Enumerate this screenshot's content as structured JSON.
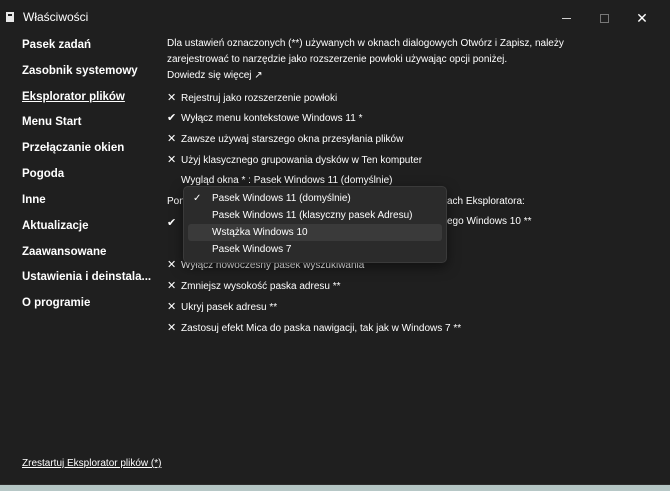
{
  "window": {
    "title": "Właściwości",
    "close_glyph": "✕"
  },
  "sidebar": {
    "items": [
      {
        "label": "Pasek zadań"
      },
      {
        "label": "Zasobnik systemowy"
      },
      {
        "label": "Eksplorator plików"
      },
      {
        "label": "Menu Start"
      },
      {
        "label": "Przełączanie okien"
      },
      {
        "label": "Pogoda"
      },
      {
        "label": "Inne"
      },
      {
        "label": "Aktualizacje"
      },
      {
        "label": "Zaawansowane"
      },
      {
        "label": "Ustawienia i deinstala..."
      },
      {
        "label": "O programie"
      }
    ],
    "restart_link": "Zrestartuj Eksplorator plików (*)"
  },
  "main": {
    "intro_line1": "Dla ustawień oznaczonych (**) używanych w oknach dialogowych Otwórz i Zapisz, należy",
    "intro_line2": "zarejestrować to narzędzie jako rozszerzenie powłoki używając opcji poniżej.",
    "learn_more": "Dowiedz się więcej ↗",
    "options_a": [
      {
        "mark": "✕",
        "label": "Rejestruj jako rozszerzenie powłoki"
      },
      {
        "mark": "✔",
        "label": "Wyłącz menu kontekstowe Windows 11 *"
      },
      {
        "mark": "✕",
        "label": "Zawsze używaj starszego okna przesyłania plików"
      },
      {
        "mark": "✕",
        "label": "Użyj klasycznego grupowania dysków w Ten komputer"
      }
    ],
    "appearance_label": "Wygląd okna * : Pasek Windows 11 (domyślnie)",
    "partial_left": "Pon",
    "partial_right": "ach Eksploratora:",
    "partial_mark": "✔",
    "partial_right2": "ego Windows 10 **",
    "options_b": [
      {
        "mark": "✕",
        "label": "Wyłącz nowoczesny pasek wyszukiwania"
      },
      {
        "mark": "✕",
        "label": "Zmniejsz wysokość paska adresu **"
      },
      {
        "mark": "✕",
        "label": "Ukryj pasek adresu **"
      },
      {
        "mark": "✕",
        "label": "Zastosuj efekt Mica do paska nawigacji, tak jak w Windows 7 **"
      }
    ]
  },
  "dropdown": {
    "check_glyph": "✓",
    "items": [
      {
        "label": "Pasek Windows 11 (domyślnie)",
        "selected": "✓"
      },
      {
        "label": "Pasek Windows 11 (klasyczny pasek Adresu)",
        "selected": ""
      },
      {
        "label": "Wstążka Windows 10",
        "selected": ""
      },
      {
        "label": "Pasek Windows 7",
        "selected": ""
      }
    ]
  }
}
